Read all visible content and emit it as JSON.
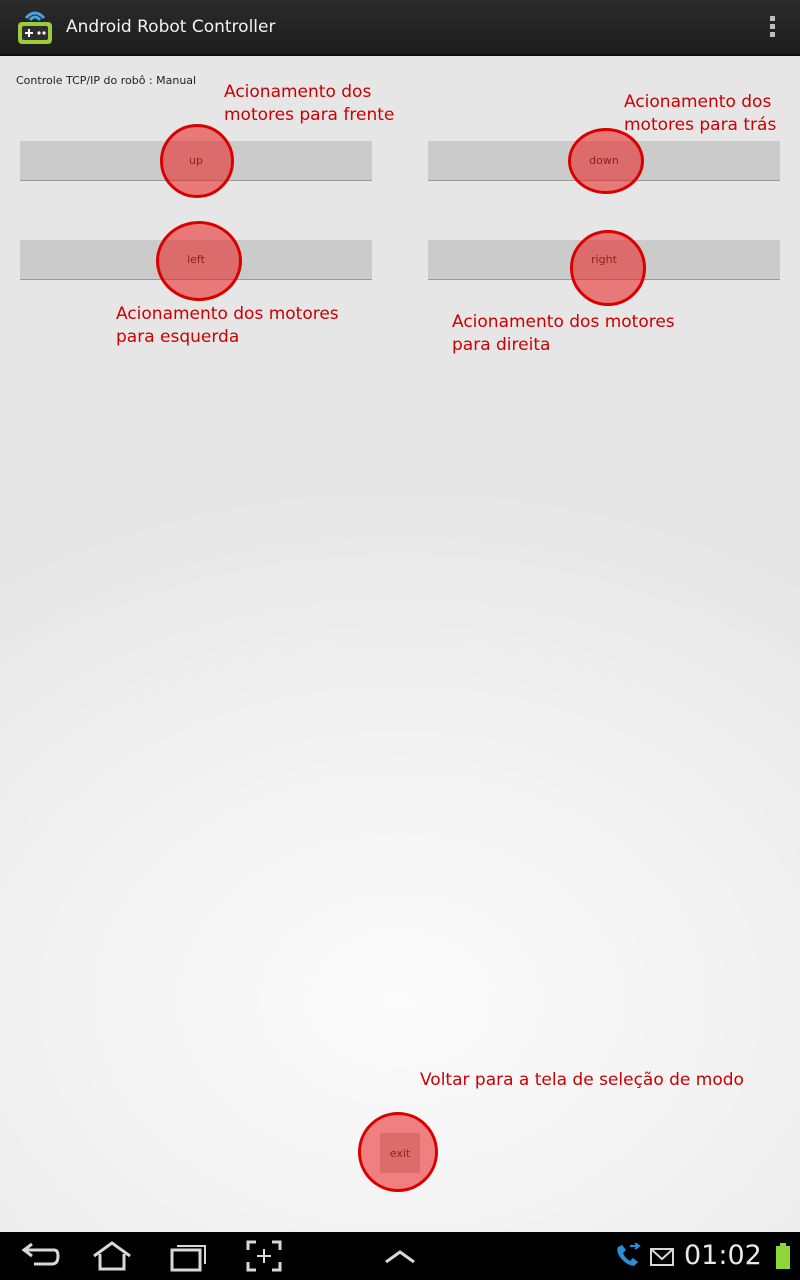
{
  "app": {
    "title": "Android Robot Controller",
    "icon": "robot-controller-icon"
  },
  "mode_label": "Controle TCP/IP do robô : Manual",
  "buttons": {
    "up": "up",
    "down": "down",
    "left": "left",
    "right": "right",
    "exit": "exit"
  },
  "annotations": {
    "up": [
      "Acionamento dos",
      "motores para frente"
    ],
    "down": [
      "Acionamento dos",
      "motores para trás"
    ],
    "left": [
      "Acionamento dos motores",
      "para esquerda"
    ],
    "right": [
      "Acionamento dos motores",
      "para direita"
    ],
    "exit": [
      "Voltar para a tela de seleção de modo"
    ]
  },
  "status_bar": {
    "time": "01:02"
  },
  "colors": {
    "annotation": "#cc0000",
    "highlight": "#eb1e1e",
    "button": "#cbcbcb",
    "action_bar": "#222222",
    "call_icon": "#2b8fd6",
    "battery": "#8ed63a"
  }
}
